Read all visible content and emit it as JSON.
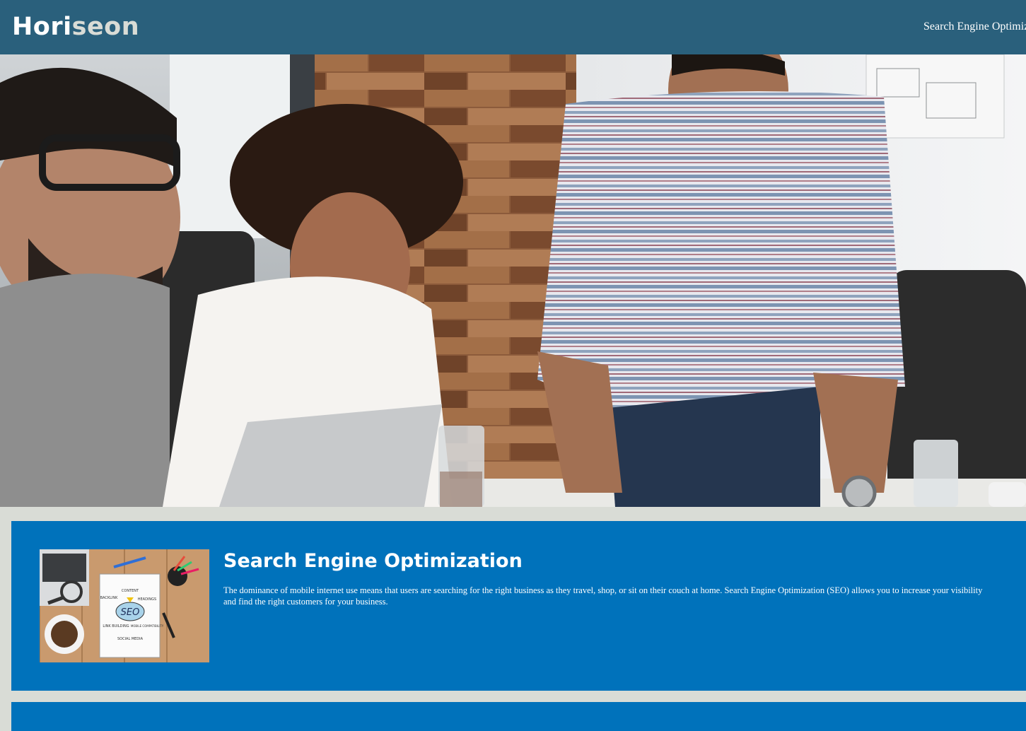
{
  "header": {
    "logo_main": "Hori",
    "logo_accent": "seon",
    "nav_item": "Search Engine Optimiz"
  },
  "hero": {
    "image": "business-meeting-photo"
  },
  "sections": [
    {
      "title": "Search Engine Optimization",
      "text": "The dominance of mobile internet use means that users are searching for the right business as they travel, shop, or sit on their couch at home. Search Engine Optimization (SEO) allows you to increase your visibility and find the right customers for your business.",
      "image": "seo-notebook-image",
      "image_labels": [
        "CONTENT",
        "BACKLINK",
        "HEADINGS",
        "SEO",
        "LINK BUILDING",
        "MOBILE COMPATIBILITY",
        "SOCIAL MEDIA"
      ]
    }
  ],
  "colors": {
    "header_bg": "#2a607c",
    "page_bg": "#d9dcd6",
    "card_bg": "#0072bb",
    "text": "#ffffff"
  }
}
